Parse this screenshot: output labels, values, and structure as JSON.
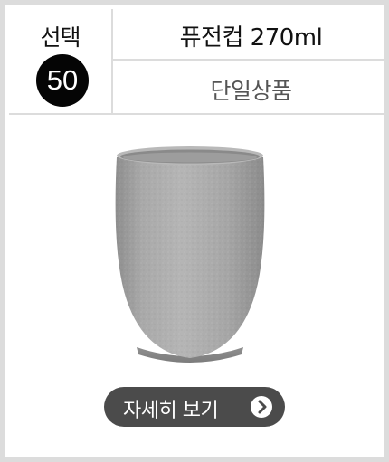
{
  "select": {
    "label": "선택",
    "number": "50"
  },
  "product": {
    "title": "퓨전컵 270ml",
    "subtitle": "단일상품"
  },
  "detail_button": {
    "label": "자세히 보기",
    "icon": "chevron-right-circle-icon"
  },
  "colors": {
    "border": "#dcdcdc",
    "badge": "#050505",
    "button": "#4b4b4b",
    "cup": "#a2a2a2"
  }
}
